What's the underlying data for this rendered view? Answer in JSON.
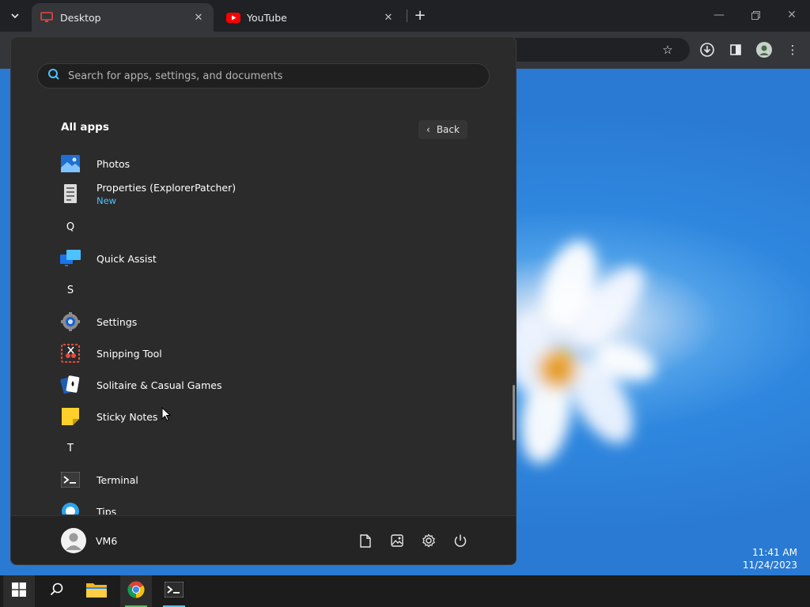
{
  "browser": {
    "tabs": [
      {
        "title": "Desktop",
        "favicon": "monitor-icon",
        "active": true
      },
      {
        "title": "YouTube",
        "favicon": "youtube-icon",
        "active": false
      }
    ]
  },
  "start_menu": {
    "search_placeholder": "Search for apps, settings, and documents",
    "section_title": "All apps",
    "back_label": "Back",
    "apps": [
      {
        "type": "app",
        "label": "Photos",
        "icon": "photos-icon"
      },
      {
        "type": "app",
        "label": "Properties (ExplorerPatcher)",
        "sub": "New",
        "icon": "properties-icon"
      },
      {
        "type": "letter",
        "label": "Q"
      },
      {
        "type": "app",
        "label": "Quick Assist",
        "icon": "quick-assist-icon"
      },
      {
        "type": "letter",
        "label": "S"
      },
      {
        "type": "app",
        "label": "Settings",
        "icon": "settings-gear-icon"
      },
      {
        "type": "app",
        "label": "Snipping Tool",
        "icon": "snipping-tool-icon"
      },
      {
        "type": "app",
        "label": "Solitaire & Casual Games",
        "icon": "solitaire-icon"
      },
      {
        "type": "app",
        "label": "Sticky Notes",
        "icon": "sticky-notes-icon"
      },
      {
        "type": "letter",
        "label": "T"
      },
      {
        "type": "app",
        "label": "Terminal",
        "icon": "terminal-icon"
      },
      {
        "type": "app",
        "label": "Tips",
        "icon": "tips-icon"
      }
    ],
    "user_name": "VM6"
  },
  "clock": {
    "time": "11:41 AM",
    "date": "11/24/2023"
  },
  "colors": {
    "accent": "#4cc2ff",
    "menu_bg": "#2b2b2b",
    "desktop_blue": "#2f87de"
  }
}
